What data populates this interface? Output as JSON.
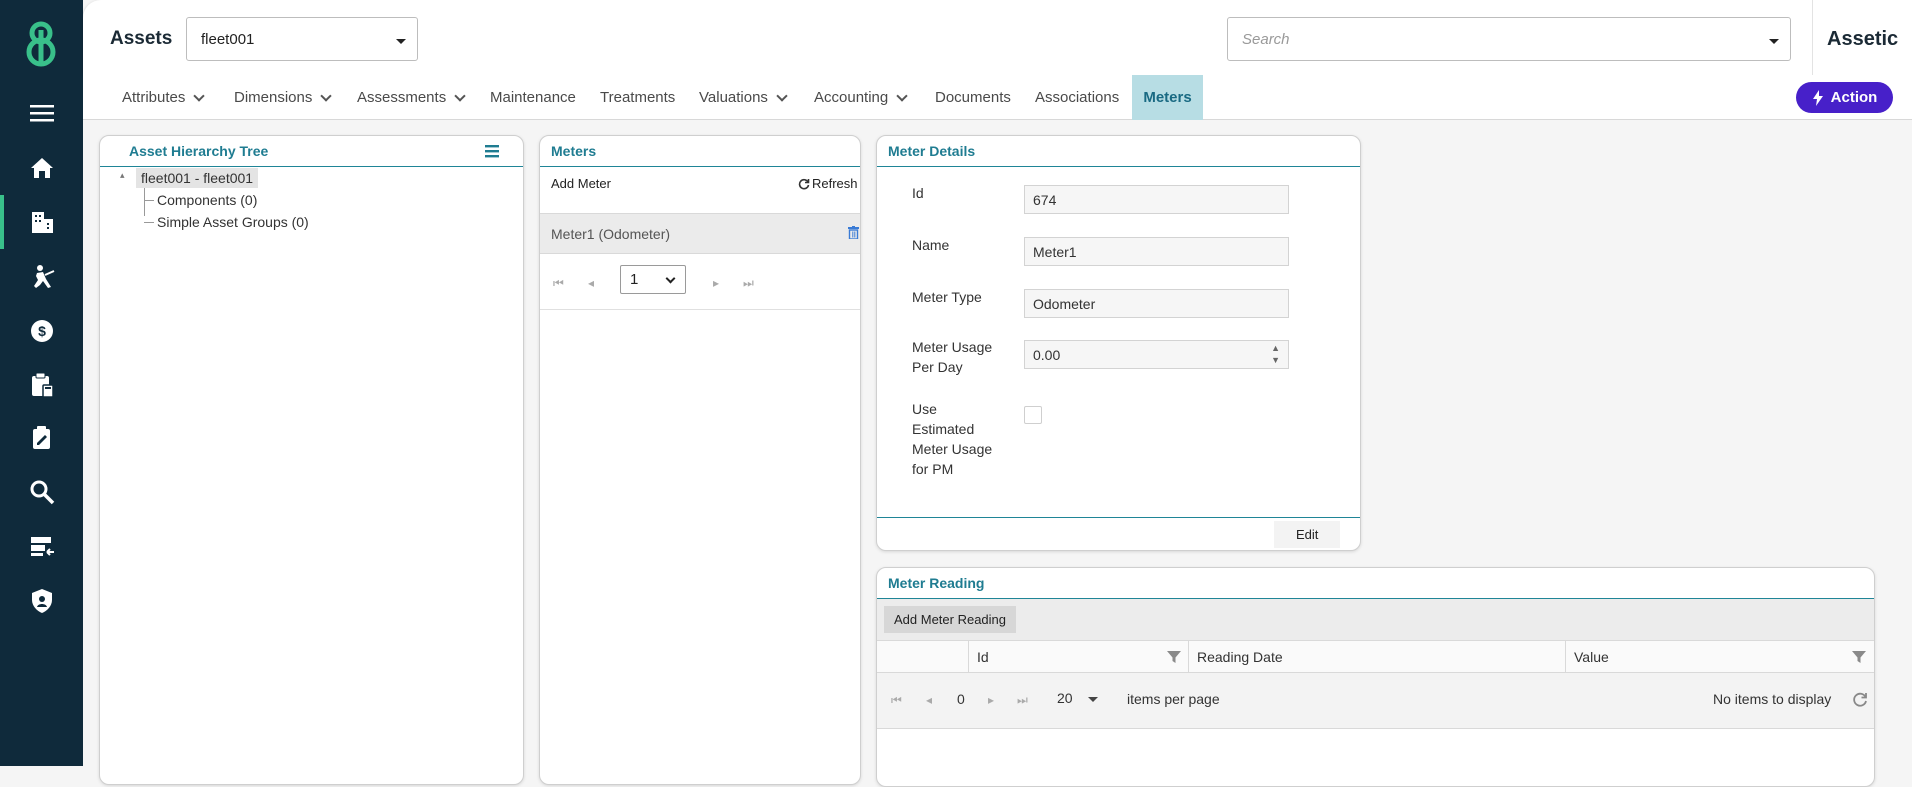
{
  "header": {
    "page_title": "Assets",
    "asset_select_value": "fleet001",
    "search_placeholder": "Search",
    "brand": "Assetic"
  },
  "nav": {
    "tabs": [
      {
        "label": "Attributes",
        "has_menu": true
      },
      {
        "label": "Dimensions",
        "has_menu": true
      },
      {
        "label": "Assessments",
        "has_menu": true
      },
      {
        "label": "Maintenance",
        "has_menu": false
      },
      {
        "label": "Treatments",
        "has_menu": false
      },
      {
        "label": "Valuations",
        "has_menu": true
      },
      {
        "label": "Accounting",
        "has_menu": true
      },
      {
        "label": "Documents",
        "has_menu": false
      },
      {
        "label": "Associations",
        "has_menu": false
      },
      {
        "label": "Meters",
        "has_menu": false,
        "active": true
      }
    ],
    "action_label": "Action"
  },
  "sidebar": {
    "items": [
      "menu-icon",
      "home-icon",
      "assets-icon",
      "work-icon",
      "finance-icon",
      "calculator-icon",
      "edit-doc-icon",
      "search-icon",
      "import-icon",
      "security-icon"
    ],
    "active_index": 2
  },
  "hierarchy": {
    "title": "Asset Hierarchy Tree",
    "root": "fleet001 - fleet001",
    "children": [
      "Components (0)",
      "Simple Asset Groups (0)"
    ]
  },
  "meters": {
    "title": "Meters",
    "add_label": "Add Meter",
    "refresh_label": "Refresh",
    "items": [
      "Meter1 (Odometer)"
    ],
    "page_value": "1"
  },
  "meter_details": {
    "title": "Meter Details",
    "fields": {
      "id_label": "Id",
      "id_value": "674",
      "name_label": "Name",
      "name_value": "Meter1",
      "type_label": "Meter Type",
      "type_value": "Odometer",
      "usage_label": "Meter Usage Per Day",
      "usage_value": "0.00",
      "estimated_label": "Use Estimated Meter Usage for PM"
    },
    "edit_label": "Edit"
  },
  "meter_reading": {
    "title": "Meter Reading",
    "add_label": "Add Meter Reading",
    "columns": [
      "Id",
      "Reading Date",
      "Value"
    ],
    "pager": {
      "page": "0",
      "page_size": "20",
      "per_page_label": "items per page",
      "empty_label": "No items to display"
    }
  },
  "colors": {
    "sidebar_bg": "#0f2a3b",
    "accent_teal": "#1f7c91",
    "action_purple": "#4720c9",
    "logo_green": "#39c08a"
  }
}
